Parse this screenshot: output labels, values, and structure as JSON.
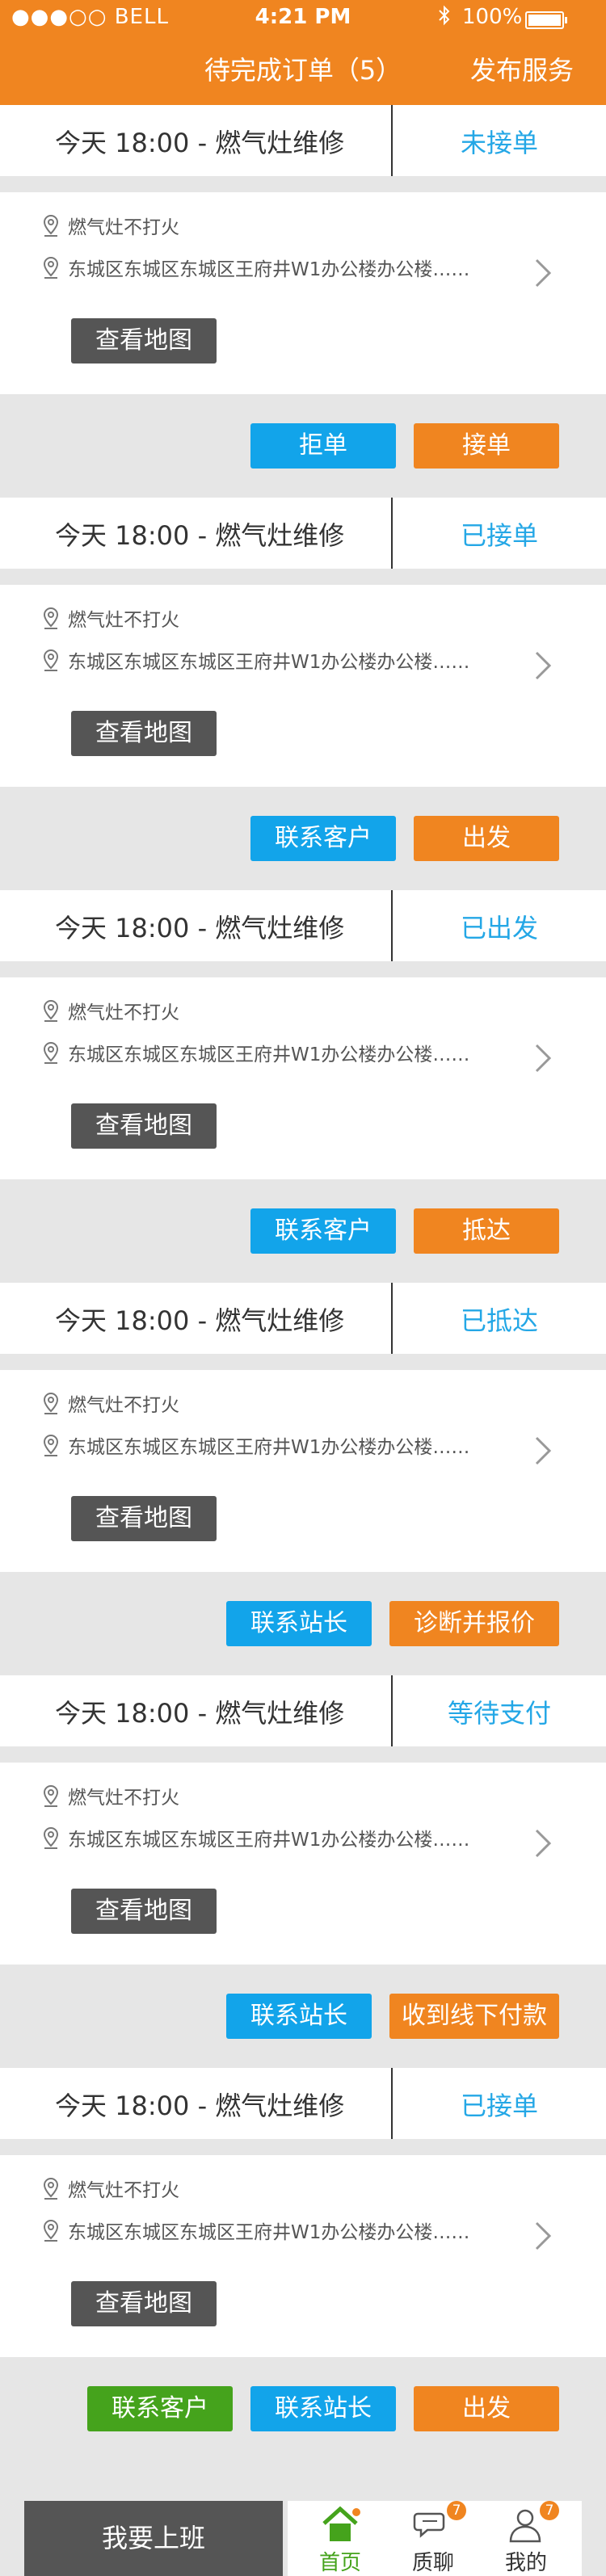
{
  "status_bar": {
    "carrier": "●●●○○ BELL",
    "time": "4:21 PM",
    "battery": "100%"
  },
  "header": {
    "title": "待完成订单（5）",
    "right_action": "发布服务"
  },
  "common": {
    "title": "今天  18:00  -  燃气灶维修",
    "fault": "燃气灶不打火",
    "address": "东城区东城区东城区王府井W1办公楼办公楼……",
    "map_label": "查看地图"
  },
  "orders": [
    {
      "status": "未接单",
      "actions": [
        "拒单",
        "接单"
      ]
    },
    {
      "status": "已接单",
      "actions": [
        "联系客户",
        "出发"
      ]
    },
    {
      "status": "已出发",
      "actions": [
        "联系客户",
        "抵达"
      ]
    },
    {
      "status": "已抵达",
      "actions": [
        "联系站长",
        "诊断并报价"
      ]
    },
    {
      "status": "等待支付",
      "actions": [
        "联系站长",
        "收到线下付款"
      ]
    },
    {
      "status": "已接单",
      "actions": [
        "联系客户",
        "联系站长",
        "出发"
      ]
    }
  ],
  "tabbar": {
    "work_label": "我要上班",
    "tabs": [
      {
        "label": "首页",
        "icon": "home-icon"
      },
      {
        "label": "质聊",
        "icon": "chat-icon",
        "badge": "7"
      },
      {
        "label": "我的",
        "icon": "user-icon",
        "badge": "7"
      }
    ]
  },
  "colors": {
    "brand": "#f08520",
    "blue": "#12a4ea",
    "green": "#45a31c",
    "status_text": "#24a7e6"
  }
}
